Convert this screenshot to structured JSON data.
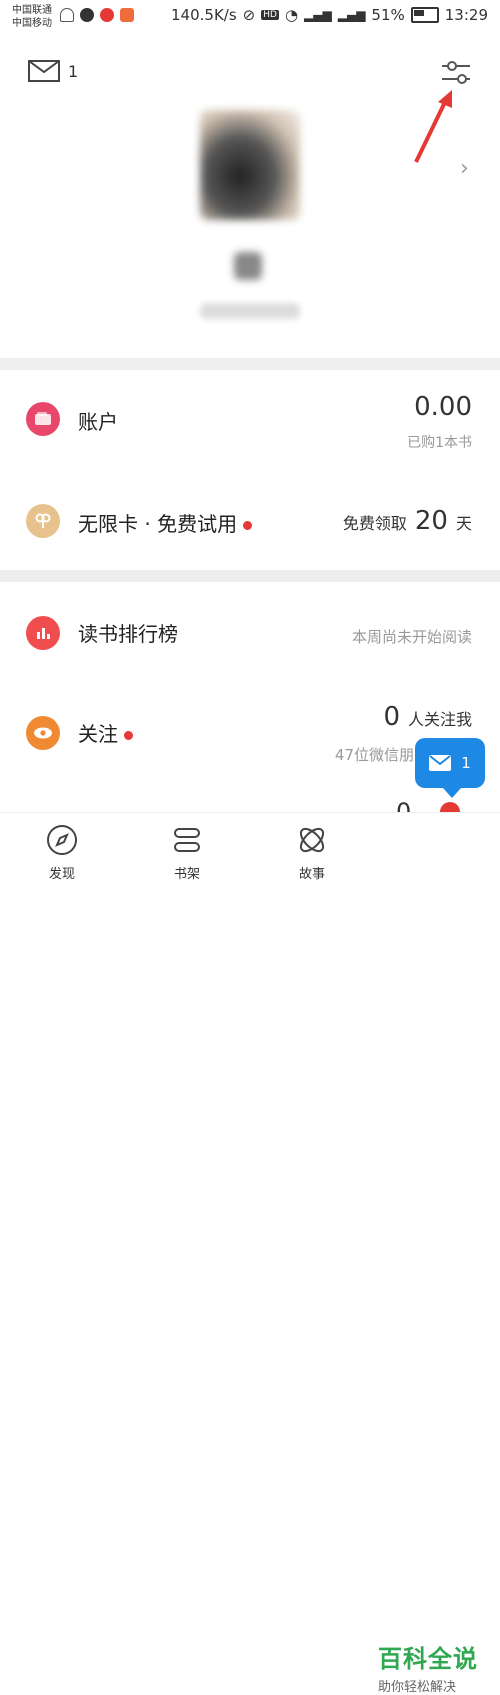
{
  "status_bar": {
    "carrier1": "中国联通",
    "carrier2": "中国移动",
    "speed": "140.5K/s",
    "battery": "51%",
    "time": "13:29"
  },
  "header": {
    "mail_count": "1"
  },
  "account": {
    "title": "账户",
    "value": "0.00",
    "sub": "已购1本书",
    "icon_color": "#e8466b"
  },
  "unlimited": {
    "title": "无限卡 · 免费试用",
    "right_prefix": "免费领取",
    "right_num": "20",
    "right_suffix": "天",
    "icon_color": "#e7c28d"
  },
  "ranking": {
    "title": "读书排行榜",
    "right": "本周尚未开始阅读",
    "icon_color": "#f04e4e"
  },
  "follow": {
    "title": "关注",
    "right_num": "0",
    "right_suffix": "人关注我",
    "sub": "47位微信朋友正",
    "icon_color": "#f08a32"
  },
  "float_message": {
    "count": "1"
  },
  "partial_row": {
    "value": "0"
  },
  "tabs": [
    {
      "label": "发现"
    },
    {
      "label": "书架"
    },
    {
      "label": "故事"
    }
  ],
  "watermark": {
    "title": "百科全说",
    "sub": "助你轻松解决"
  }
}
